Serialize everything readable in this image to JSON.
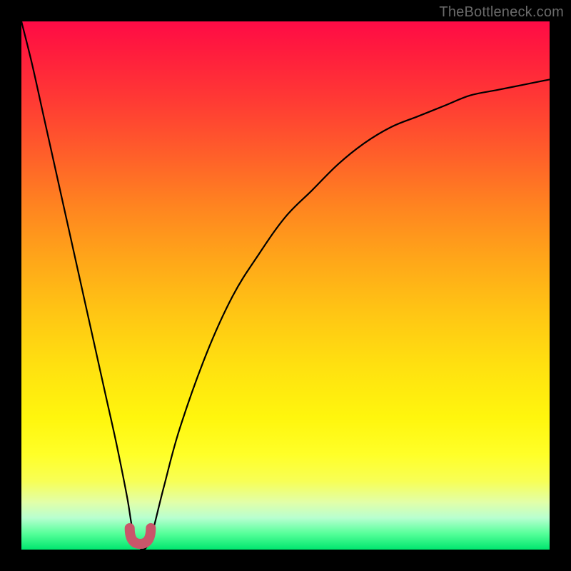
{
  "watermark": "TheBottleneck.com",
  "chart_data": {
    "type": "line",
    "title": "",
    "xlabel": "",
    "ylabel": "",
    "xlim": [
      0,
      100
    ],
    "ylim": [
      0,
      100
    ],
    "series": [
      {
        "name": "bottleneck-curve",
        "x": [
          0,
          2,
          4,
          6,
          8,
          10,
          12,
          14,
          16,
          18,
          20,
          21,
          22,
          23,
          24,
          25,
          27,
          30,
          35,
          40,
          45,
          50,
          55,
          60,
          65,
          70,
          75,
          80,
          85,
          90,
          95,
          100
        ],
        "values": [
          100,
          92,
          83,
          74,
          65,
          56,
          47,
          38,
          29,
          20,
          10,
          4,
          1,
          0,
          1,
          4,
          12,
          23,
          37,
          48,
          56,
          63,
          68,
          73,
          77,
          80,
          82,
          84,
          86,
          87,
          88,
          89
        ]
      }
    ],
    "annotations": [
      {
        "name": "optimal-marker",
        "x_range": [
          20.5,
          24.5
        ],
        "y": 0
      }
    ],
    "background_gradient": {
      "top": "#ff0b46",
      "mid": "#ffd400",
      "bottom": "#00e66e"
    }
  }
}
